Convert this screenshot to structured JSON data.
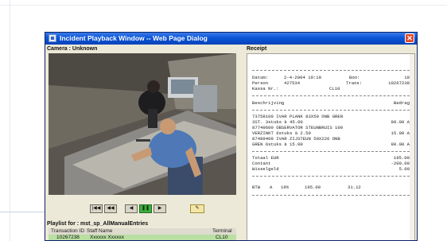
{
  "window": {
    "title": "Incident Playback Window -- Web Page Dialog"
  },
  "camera": {
    "header": "Camera : Unknown"
  },
  "receipt": {
    "header": "Receipt",
    "datum_label": "Datum:",
    "datum_value": "2-4-2004 10:10",
    "bon_label": "Bon:",
    "bon_value": "10",
    "person_label": "Person",
    "person_value": "427534",
    "trans_label": "Trans:",
    "trans_value": "10267238",
    "kassa_label": "Kassa Nr.:",
    "kassa_value": "CL10",
    "col_desc": "Beschrijving",
    "col_amount": "Bedrag",
    "items": [
      {
        "line1": "73758109 IVAR PLANK 83X50 ONB GREN",
        "line2": "3ST. 3stuks à 45.00",
        "amount": "90.00 A"
      },
      {
        "line1": "87749600 OBSERVATOR STEUNBRUIS 100",
        "line2": "VERZINKT 6stuks à 2.50",
        "amount": "15.00 A"
      },
      {
        "line1": "87489409 IVAR ZIJSTEUN 50X226 ONB",
        "line2": "GREN 6stuks à 15.00",
        "amount": "90.00 A"
      }
    ],
    "total_label": "Totaal EUR",
    "total_value": "195.00",
    "contant_label": "Contant",
    "contant_value": "-200.00",
    "wissel_label": "Wisselgeld",
    "wissel_value": "5.00",
    "btw_label": "BTW",
    "btw_code": "A",
    "btw_pct": "19%",
    "btw_base": "195.00",
    "btw_amount": "31.12"
  },
  "controls": {
    "buttons": [
      {
        "name": "first-frame-button",
        "glyph": "|◀◀"
      },
      {
        "name": "previous-frame-button",
        "glyph": "◀◀"
      },
      {
        "name": "step-back-button",
        "glyph": "◀"
      },
      {
        "name": "pause-button",
        "glyph": "❚❚"
      },
      {
        "name": "play-button",
        "glyph": "▶"
      },
      {
        "name": "export-button",
        "glyph": "✎"
      }
    ]
  },
  "playlist": {
    "header": "Playlist for : mst_sp_AllManualEntries",
    "columns": [
      "Transaction ID",
      "Staff Name",
      "Terminal"
    ],
    "rows": [
      [
        "10267238",
        "Xxxxxx Xxxxxx",
        "CL10"
      ]
    ]
  },
  "colors": {
    "title_bar": "#0a55d8",
    "selected_row": "#b9dfa2",
    "play_button": "#3fae3f",
    "close_button": "#e04a2a"
  }
}
